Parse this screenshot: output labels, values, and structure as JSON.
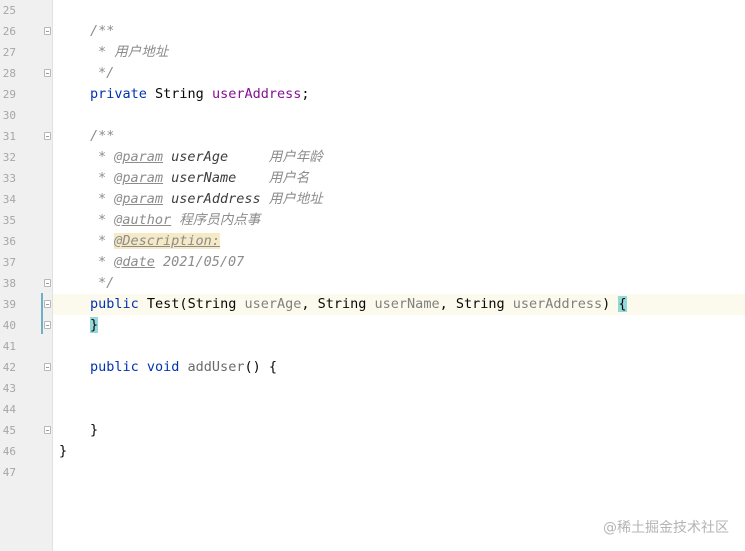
{
  "line_numbers": [
    "25",
    "26",
    "27",
    "28",
    "29",
    "30",
    "31",
    "32",
    "33",
    "34",
    "35",
    "36",
    "37",
    "38",
    "39",
    "40",
    "41",
    "42",
    "43",
    "44",
    "45",
    "46",
    "47"
  ],
  "code": {
    "l26": "/**",
    "l27_star": "* ",
    "l27_text": "用户地址",
    "l28": "*/",
    "l29_kw": "private",
    "l29_type": " String ",
    "l29_field": "userAddress",
    "l29_end": ";",
    "l31": "/**",
    "star": "* ",
    "l32_tag": "@param",
    "l32_name": " userAge",
    "l32_desc": "     用户年龄",
    "l33_tag": "@param",
    "l33_name": " userName",
    "l33_desc": "    用户名",
    "l34_tag": "@param",
    "l34_name": " userAddress",
    "l34_desc": " 用户地址",
    "l35_tag": "@author",
    "l35_desc": " 程序员内点事",
    "l36_tag": "@Description:",
    "l37_tag": "@date",
    "l37_desc": " 2021/05/07",
    "l38": "*/",
    "l39_kw": "public",
    "l39_method": " Test(",
    "l39_t1": "String ",
    "l39_p1": "userAge",
    "l39_c1": ", ",
    "l39_t2": "String ",
    "l39_p2": "userName",
    "l39_c2": ", ",
    "l39_t3": "String ",
    "l39_p3": "userAddress",
    "l39_close": ") ",
    "l39_brace": "{",
    "l40_brace": "}",
    "l42_kw1": "public",
    "l42_kw2": " void",
    "l42_method": " addUser",
    "l42_rest": "() {",
    "l45": "}",
    "l46": "}"
  },
  "colors": {
    "keyword": "#0033b3",
    "field": "#871094",
    "comment": "#8c8c8c",
    "unused_param": "#808080",
    "brace_match": "#93d9d9",
    "current_line": "#fcfaed"
  },
  "watermark": "@稀土掘金技术社区"
}
